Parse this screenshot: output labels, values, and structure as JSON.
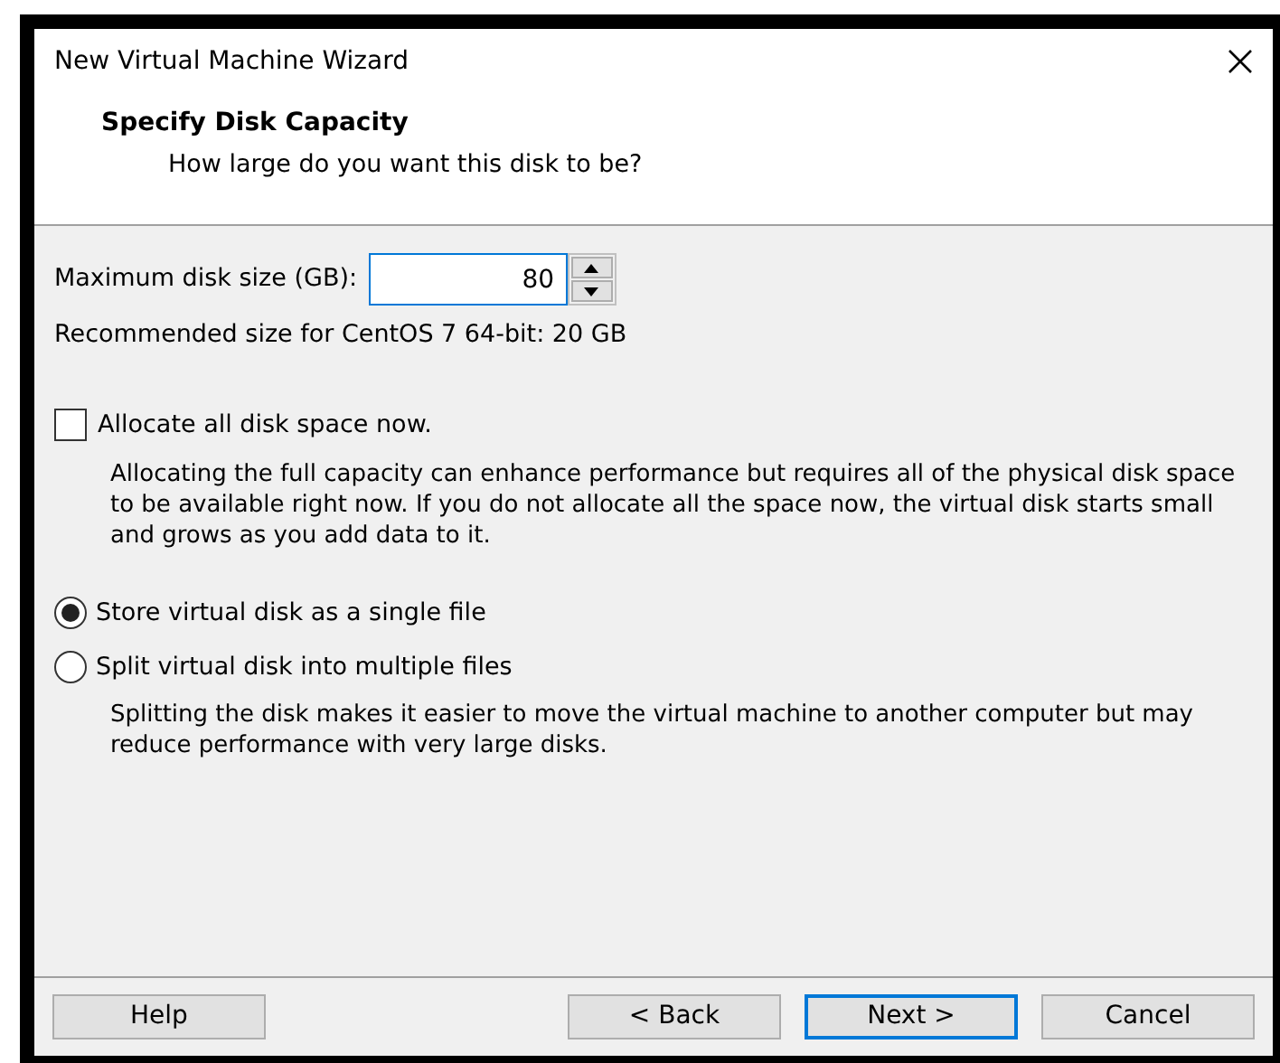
{
  "window": {
    "title": "New Virtual Machine Wizard"
  },
  "header": {
    "title": "Specify Disk Capacity",
    "subtitle": "How large do you want this disk to be?"
  },
  "disk_size": {
    "label": "Maximum disk size (GB):",
    "value": "80",
    "recommendation": "Recommended size for CentOS 7 64-bit: 20 GB"
  },
  "allocate": {
    "label": "Allocate all disk space now.",
    "checked": false,
    "description": "Allocating the full capacity can enhance performance but requires all of the physical disk space to be available right now. If you do not allocate all the space now, the virtual disk starts small and grows as you add data to it."
  },
  "storage_options": [
    {
      "label": "Store virtual disk as a single file",
      "selected": true
    },
    {
      "label": "Split virtual disk into multiple files",
      "selected": false,
      "description": "Splitting the disk makes it easier to move the virtual machine to another computer but may reduce performance with very large disks."
    }
  ],
  "buttons": [
    {
      "label": "Help",
      "default": false
    },
    {
      "label": "< Back",
      "default": false
    },
    {
      "label": "Next >",
      "default": true
    },
    {
      "label": "Cancel",
      "default": false
    }
  ]
}
